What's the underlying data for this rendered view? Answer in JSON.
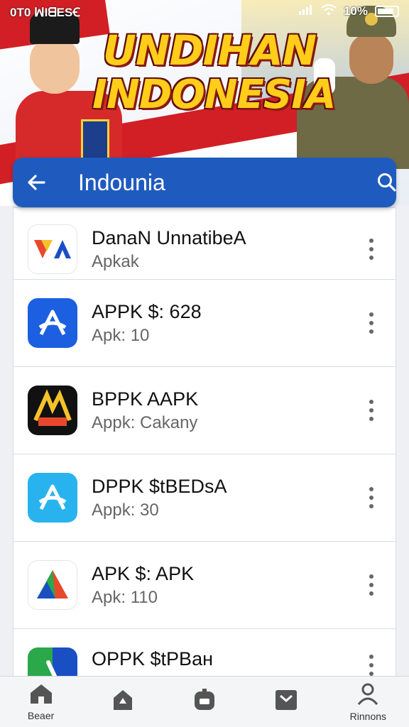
{
  "status_bar": {
    "time": "0T0 ꟽIᗺESꞒ",
    "battery": "10%"
  },
  "banner": {
    "title_line1": "UNDIHAN",
    "title_line2": "INDONESIA"
  },
  "search": {
    "value": "Indounia",
    "placeholder": ""
  },
  "apps": [
    {
      "name": "DanaN UnnatibeA",
      "sub": "Apkak",
      "icon": "va-logo-icon"
    },
    {
      "name": "APPK $: 628",
      "sub": "Apk: 10",
      "icon": "blue-a-icon"
    },
    {
      "name": "BPPK AAPK",
      "sub": "Appk: Cakany",
      "icon": "game-logo-icon"
    },
    {
      "name": "DPPK $tBEDsA",
      "sub": "Appk: 30",
      "icon": "cyan-a-icon"
    },
    {
      "name": "APK $: APK",
      "sub": "Apk: 110",
      "icon": "triangle-logo-icon"
    },
    {
      "name": "OPPK $tPBaн",
      "sub": "",
      "icon": "green-blue-icon"
    }
  ],
  "bottom_nav": [
    {
      "label": "Beaer",
      "icon": "home-icon"
    },
    {
      "label": "",
      "icon": "store-icon"
    },
    {
      "label": "",
      "icon": "apps-icon"
    },
    {
      "label": "",
      "icon": "inbox-icon"
    },
    {
      "label": "Rinnons",
      "icon": "profile-icon"
    }
  ],
  "colors": {
    "search_bar": "#1f5bbf",
    "banner_text": "#ffcd1a",
    "red_stripe": "#d11f25"
  }
}
